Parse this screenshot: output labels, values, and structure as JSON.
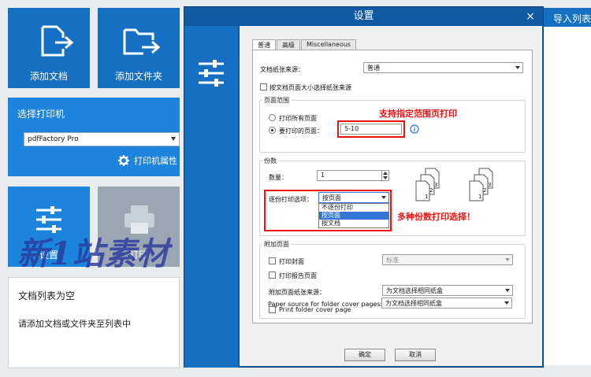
{
  "app": {
    "tiles": {
      "add_doc": "添加文档",
      "add_folder": "添加文件夹",
      "settings": "设置",
      "print": "打印"
    },
    "printer": {
      "title": "选择打印机",
      "selected": "pdfFactory Pro",
      "properties": "打印机属性"
    },
    "doclist": {
      "empty_title": "文档列表为空",
      "empty_hint": "请添加文档或文件夹至列表中"
    },
    "import_label": "导入列表"
  },
  "watermark": "新1站素材",
  "dialog": {
    "title": "设置",
    "close": "×",
    "tabs": [
      "普通",
      "高级",
      "Miscellaneous"
    ],
    "paper_source_label": "文档纸张来源：",
    "paper_source_value": "普通",
    "by_page_size_label": "按文档页面大小选择纸张来源",
    "page_range": {
      "title": "页面范围",
      "all_pages": "打印所有页面",
      "pages_to_print": "要打印的页面：",
      "pages_value": "5-10"
    },
    "copies": {
      "title": "份数",
      "count_label": "数量：",
      "count_value": "1",
      "collate_label": "逐份打印选项：",
      "collate_value": "按页面",
      "collate_options": [
        "不逐份打印",
        "按页面",
        "按文档"
      ]
    },
    "extra_pages": {
      "title": "附加页面",
      "print_cover": "打印封面",
      "cover_value": "标准",
      "print_report": "打印报告页面",
      "extra_paper_label": "附加页面纸张来源：",
      "extra_paper_value": "为文档选择相同纸盒",
      "print_folder_cover": "Print folder cover page",
      "folder_paper_label": "Paper source for folder cover pages:",
      "folder_paper_value": "为文档选择相同纸盒"
    },
    "ok": "确定",
    "cancel": "取消"
  },
  "annotations": {
    "range_note": "支持指定范围页打印",
    "copies_note": "多种份数打印选择！"
  },
  "colors": {
    "tile_blue": "#1570c3",
    "dialog_blue": "#0f5aa3",
    "annotation_red": "#e11111",
    "info_icon": "#2a6fd6"
  }
}
